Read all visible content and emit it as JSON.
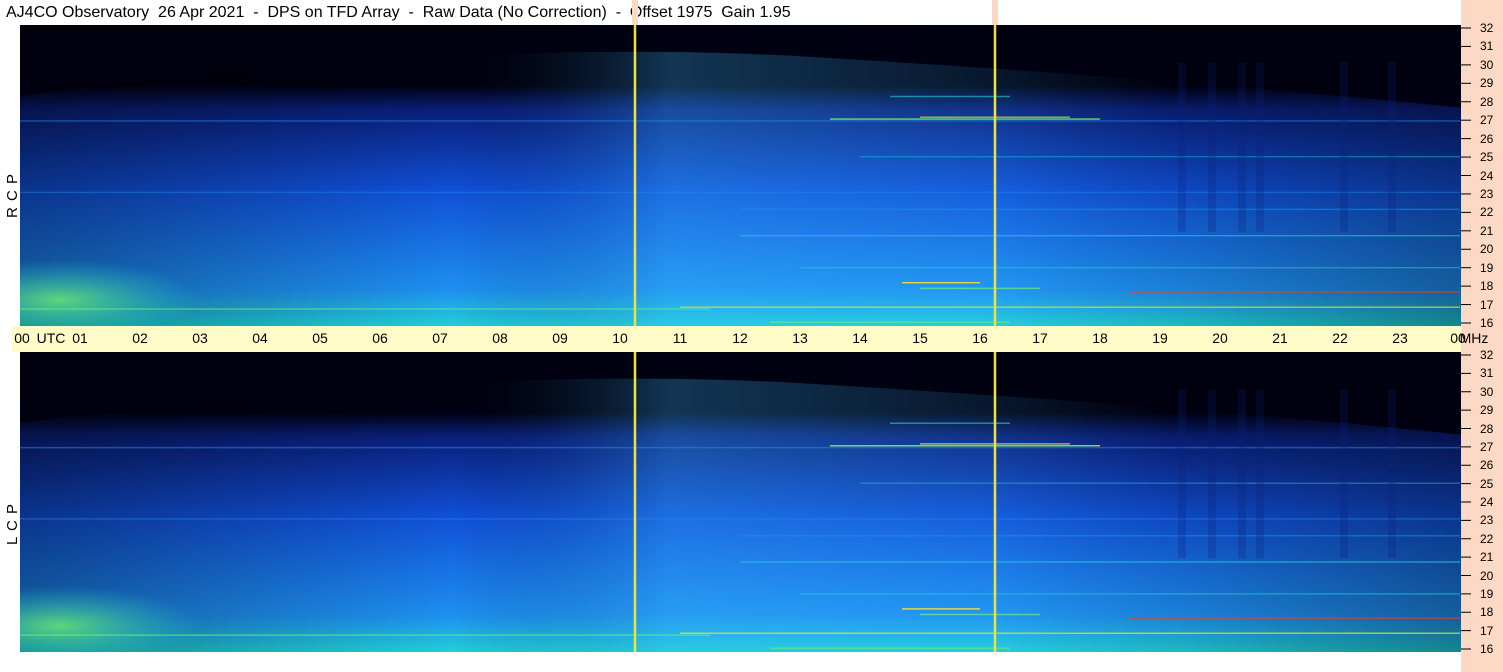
{
  "title": "AJ4CO Observatory  26 Apr 2021  -  DPS on TFD Array  -  Raw Data (No Correction)  -  Offset 1975  Gain 1.95",
  "chart_data": [
    {
      "type": "heatmap",
      "polarization": "R C P",
      "xlabel": "UTC",
      "ylabel": "MHz",
      "x_ticks": [
        "00",
        "01",
        "02",
        "03",
        "04",
        "05",
        "06",
        "07",
        "08",
        "09",
        "10",
        "11",
        "12",
        "13",
        "14",
        "15",
        "16",
        "17",
        "18",
        "19",
        "20",
        "21",
        "22",
        "23",
        "00"
      ],
      "y_ticks": [
        32,
        31,
        30,
        29,
        28,
        27,
        26,
        25,
        24,
        23,
        22,
        21,
        20,
        19,
        18,
        17,
        16
      ],
      "xlim": [
        0,
        24
      ],
      "ylim": [
        16,
        32
      ],
      "vertical_lines_utc": [
        10.25,
        16.25
      ],
      "colormap": [
        "#000010",
        "#0a1e78",
        "#1050d8",
        "#1e90f0",
        "#20d0d8",
        "#70f070",
        "#f0e040",
        "#f04020"
      ]
    },
    {
      "type": "heatmap",
      "polarization": "L C P",
      "xlabel": "UTC",
      "ylabel": "MHz",
      "x_ticks": [
        "00",
        "01",
        "02",
        "03",
        "04",
        "05",
        "06",
        "07",
        "08",
        "09",
        "10",
        "11",
        "12",
        "13",
        "14",
        "15",
        "16",
        "17",
        "18",
        "19",
        "20",
        "21",
        "22",
        "23",
        "00"
      ],
      "y_ticks": [
        32,
        31,
        30,
        29,
        28,
        27,
        26,
        25,
        24,
        23,
        22,
        21,
        20,
        19,
        18,
        17,
        16
      ],
      "xlim": [
        0,
        24
      ],
      "ylim": [
        16,
        32
      ],
      "vertical_lines_utc": [
        10.25,
        16.25
      ],
      "colormap": [
        "#000010",
        "#0a1e78",
        "#1050d8",
        "#1e90f0",
        "#20d0d8",
        "#70f070",
        "#f0e040",
        "#f04020"
      ]
    }
  ]
}
